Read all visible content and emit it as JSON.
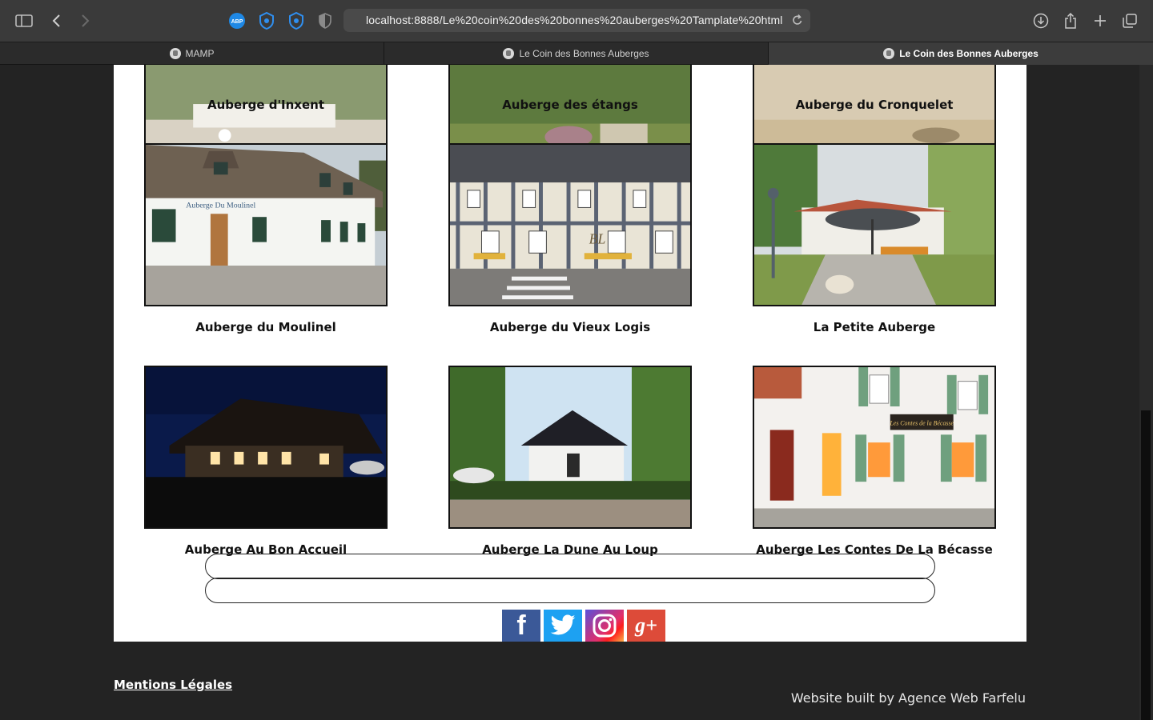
{
  "browser": {
    "url_host": "localhost:8888",
    "url_path": "/Le%20coin%20des%20bonnes%20auberges%20Tamplate%20html/Le",
    "tabs": [
      {
        "label": "MAMP"
      },
      {
        "label": "Le Coin des Bonnes Auberges"
      },
      {
        "label": "Le Coin des Bonnes Auberges"
      }
    ],
    "extensions": [
      "ABP"
    ]
  },
  "gallery": {
    "row0": [
      "Auberge d'Inxent",
      "Auberge des étangs",
      "Auberge du Cronquelet"
    ],
    "row1": [
      "Auberge du Moulinel",
      "Auberge du Vieux Logis",
      "La Petite Auberge"
    ],
    "row2": [
      "Auberge Au Bon Accueil",
      "Auberge La Dune Au Loup",
      "Auberge Les Contes De La Bécasse"
    ],
    "photo_texts": {
      "moulinel_sign": "Auberge Du Moulinel",
      "becasse_sign": "Les Contes de la Bécasse",
      "vieux_logis_sign": "BL"
    }
  },
  "social": {
    "facebook": "f",
    "twitter": "twitter",
    "instagram": "instagram",
    "googleplus": "g+"
  },
  "footer": {
    "mentions": "Mentions Légales",
    "credit": "Website built by Agence Web Farfelu"
  },
  "colors": {
    "facebook": "#3b5998",
    "twitter": "#1da1f2",
    "googleplus": "#dd4b39",
    "page_bg": "#232323"
  }
}
